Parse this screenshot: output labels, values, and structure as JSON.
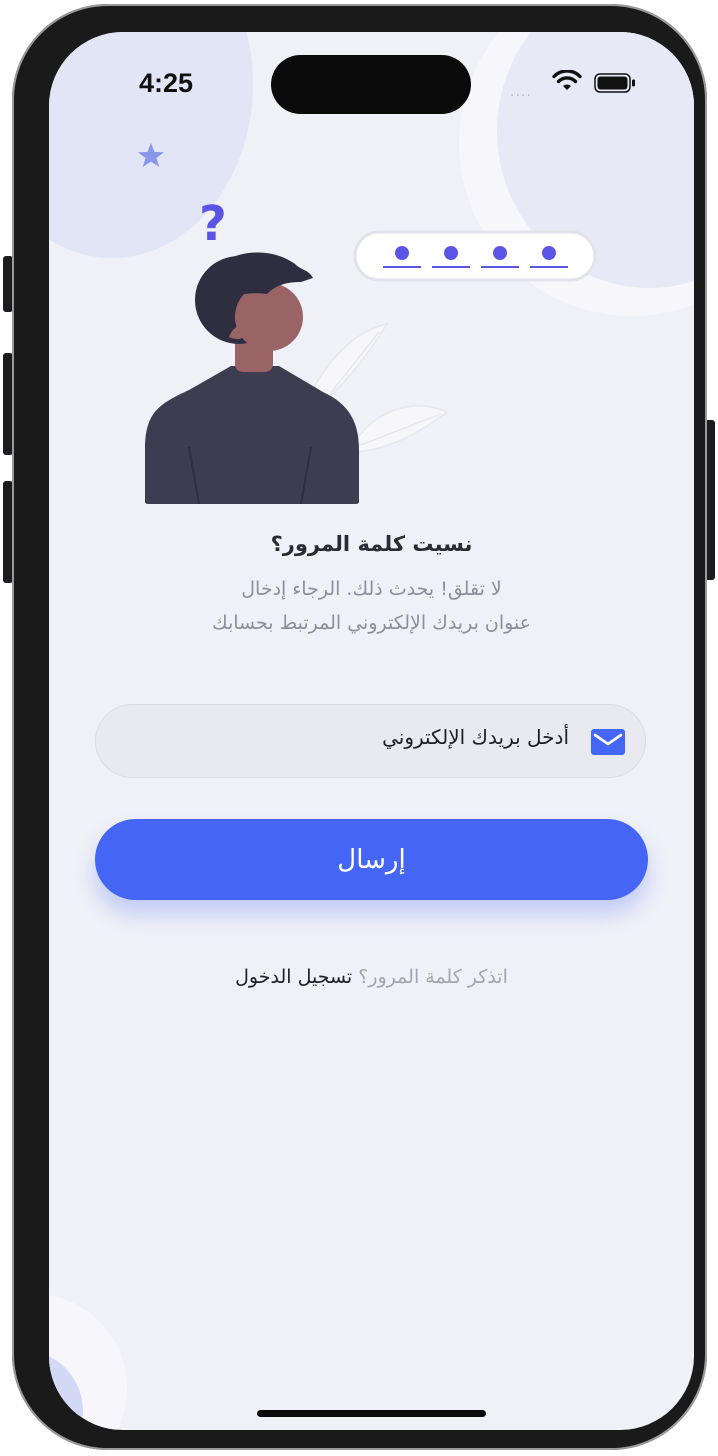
{
  "status_bar": {
    "time": "4:25",
    "signal": "....",
    "wifi_icon": "wifi-icon",
    "battery_icon": "battery-icon"
  },
  "illustration": {
    "question_mark": "?",
    "password_dots": [
      "•",
      "•",
      "•",
      "•"
    ]
  },
  "content": {
    "title": "نسيت كلمة المرور؟",
    "description_line1": "لا تقلق! يحدث ذلك. الرجاء إدخال",
    "description_line2": "عنوان بريدك الإلكتروني المرتبط بحسابك"
  },
  "email_field": {
    "placeholder": "أدخل بريدك الإلكتروني",
    "icon": "envelope-icon"
  },
  "submit_button": {
    "label": "إرسال"
  },
  "footer": {
    "question": "اتذكر كلمة المرور؟",
    "link_label": "تسجيل الدخول"
  },
  "colors": {
    "accent": "#4565f5",
    "background": "#f0f1f7",
    "title": "#2a2b33",
    "muted": "#8d8f98"
  }
}
